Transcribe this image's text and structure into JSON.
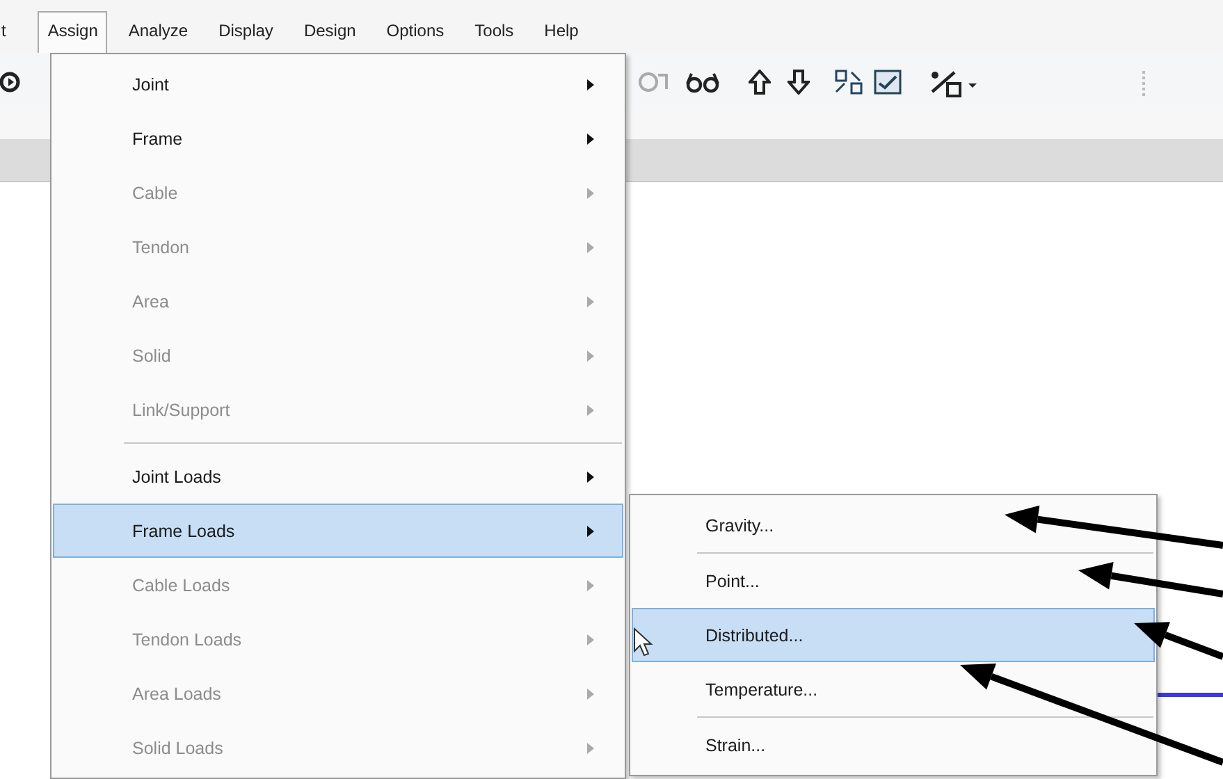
{
  "menubar": {
    "items": [
      {
        "label": "t",
        "selected": false
      },
      {
        "label": "Assign",
        "selected": true
      },
      {
        "label": "Analyze",
        "selected": false
      },
      {
        "label": "Display",
        "selected": false
      },
      {
        "label": "Design",
        "selected": false
      },
      {
        "label": "Options",
        "selected": false
      },
      {
        "label": "Tools",
        "selected": false
      },
      {
        "label": "Help",
        "selected": false
      }
    ]
  },
  "menu": {
    "items": [
      {
        "kind": "item",
        "label": "Joint",
        "disabled": false,
        "selected": false,
        "submenu": true
      },
      {
        "kind": "item",
        "label": "Frame",
        "disabled": false,
        "selected": false,
        "submenu": true
      },
      {
        "kind": "item",
        "label": "Cable",
        "disabled": true,
        "selected": false,
        "submenu": true
      },
      {
        "kind": "item",
        "label": "Tendon",
        "disabled": true,
        "selected": false,
        "submenu": true
      },
      {
        "kind": "item",
        "label": "Area",
        "disabled": true,
        "selected": false,
        "submenu": true
      },
      {
        "kind": "item",
        "label": "Solid",
        "disabled": true,
        "selected": false,
        "submenu": true
      },
      {
        "kind": "item",
        "label": "Link/Support",
        "disabled": true,
        "selected": false,
        "submenu": true
      },
      {
        "kind": "separator"
      },
      {
        "kind": "item",
        "label": "Joint Loads",
        "disabled": false,
        "selected": false,
        "submenu": true
      },
      {
        "kind": "item",
        "label": "Frame Loads",
        "disabled": false,
        "selected": true,
        "submenu": true
      },
      {
        "kind": "item",
        "label": "Cable Loads",
        "disabled": true,
        "selected": false,
        "submenu": true
      },
      {
        "kind": "item",
        "label": "Tendon Loads",
        "disabled": true,
        "selected": false,
        "submenu": true
      },
      {
        "kind": "item",
        "label": "Area Loads",
        "disabled": true,
        "selected": false,
        "submenu": true
      },
      {
        "kind": "item",
        "label": "Solid Loads",
        "disabled": true,
        "selected": false,
        "submenu": true
      }
    ]
  },
  "submenu": {
    "items": [
      {
        "kind": "item",
        "label": "Gravity...",
        "disabled": false,
        "selected": false,
        "submenu": false
      },
      {
        "kind": "separator"
      },
      {
        "kind": "item",
        "label": "Point...",
        "disabled": false,
        "selected": false,
        "submenu": false
      },
      {
        "kind": "item",
        "label": "Distributed...",
        "disabled": false,
        "selected": true,
        "submenu": false
      },
      {
        "kind": "item",
        "label": "Temperature...",
        "disabled": false,
        "selected": false,
        "submenu": false
      },
      {
        "kind": "separator"
      },
      {
        "kind": "item",
        "label": "Strain...",
        "disabled": false,
        "selected": false,
        "submenu": false
      }
    ]
  }
}
